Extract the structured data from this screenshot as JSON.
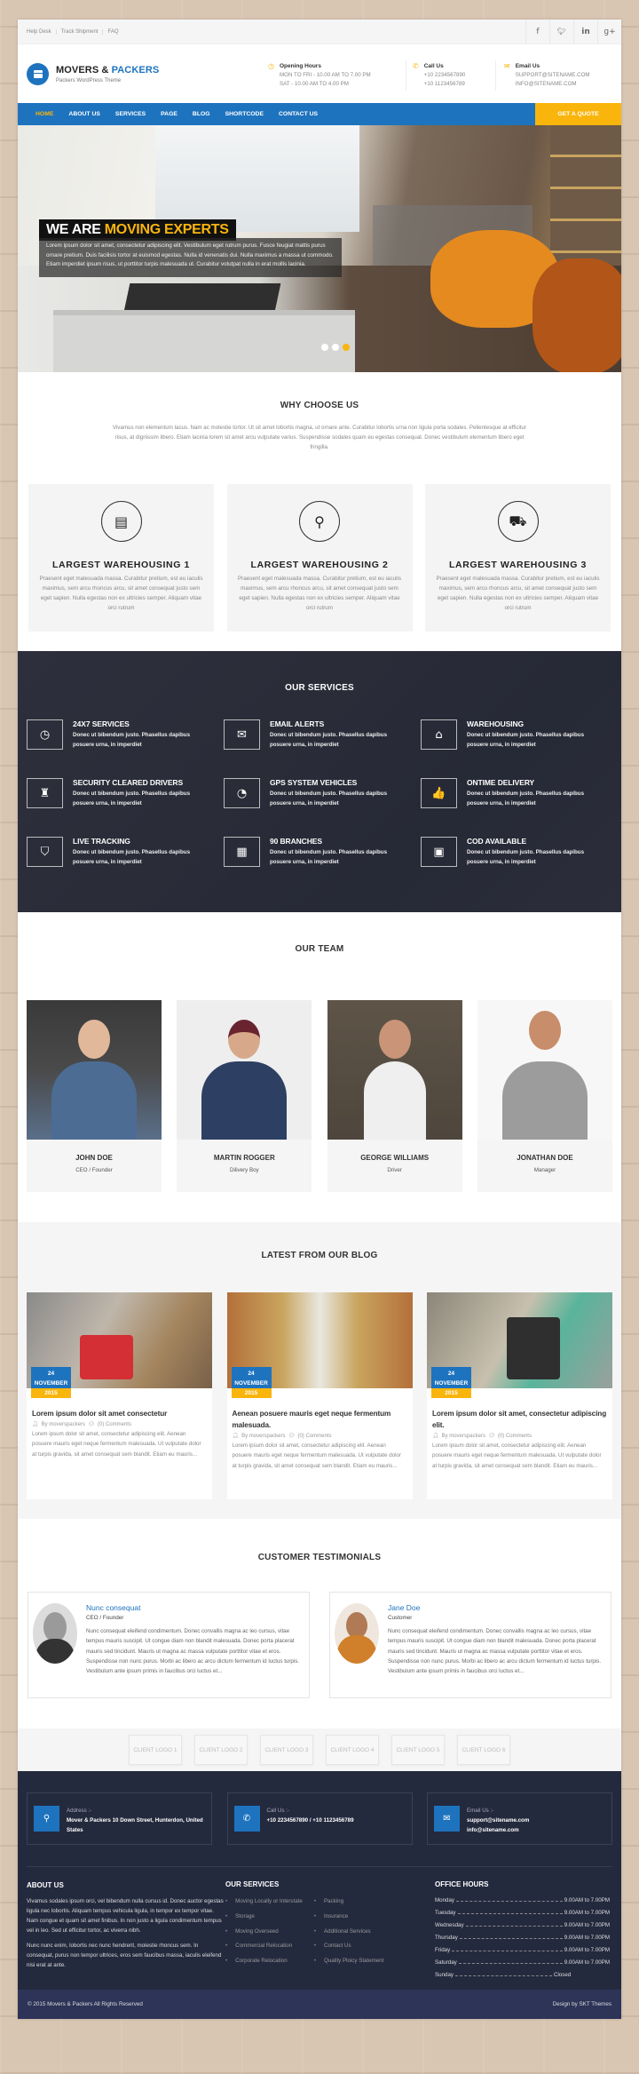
{
  "topbar": {
    "links": [
      "Help Desk",
      "Track Shipment",
      "FAQ"
    ],
    "social": [
      {
        "name": "facebook-icon",
        "glyph": "f"
      },
      {
        "name": "twitter-icon",
        "glyph": "t"
      },
      {
        "name": "linkedin-icon",
        "glyph": "in"
      },
      {
        "name": "google-plus-icon",
        "glyph": "g+"
      }
    ]
  },
  "header": {
    "logo_title_a": "MOVERS & ",
    "logo_title_b": "PACKERS",
    "logo_sub": "Packers WordPress Theme",
    "hours": {
      "title": "Opening Hours",
      "line1": "MON TO FRI - 10.00 AM TO 7.00 PM",
      "line2": "SAT - 10.00 AM TO 4.00 PM"
    },
    "call": {
      "title": "Call Us",
      "line1": "+10 2234567890",
      "line2": "+10 1123456789"
    },
    "email": {
      "title": "Email Us",
      "line1": "SUPPORT@SITENAME.COM",
      "line2": "INFO@SITENAME.COM"
    }
  },
  "nav": {
    "items": [
      "HOME",
      "ABOUT US",
      "SERVICES",
      "PAGE",
      "BLOG",
      "SHORTCODE",
      "CONTACT US"
    ],
    "active": "HOME",
    "cta": "GET A QUOTE"
  },
  "hero": {
    "title_a": "WE ARE ",
    "title_b": "MOVING EXPERTS",
    "text": "Lorem ipsum dolor sit amet, consectetur adipiscing elit. Vestibulum eget rutrum purus. Fusce feugiat mattis purus ornare pretium. Duis facilisis tortor at euismod egestas. Nulla id venenatis dui. Nulla maximus a massa ut commodo. Etiam imperdiet ipsum risus, ut porttitor turpis malesuada ut. Curabitur volutpat nulla in erat mollis lacinia.",
    "slides": 3,
    "active_slide": 3
  },
  "why": {
    "title": "WHY CHOOSE US",
    "intro": "Vivamus non elementum lacus. Nam ac molestie tortor. Ut sit amet lobortis magna, ut ornare ante. Curabitur lobortis urna non ligula porta sodales. Pellentesque at efficitur risus, at dignissim libero. Etiam lacinia lorem sit amet arcu vulputate varius. Suspendisse sodales quam eu egestas consequat. Donec vestibulum elementum libero eget fringilla.",
    "cards": [
      {
        "icon": "archive-box-icon",
        "title": "LARGEST WAREHOUSING 1",
        "text": "Praesent eget malesuada massa. Curabitur pretium, est eu iaculis maximus, sem arcu rhoncus arcu, sit amet consequat justo sem eget sapien. Nulla egestas non ex ultricies semper. Aliquam vitae orci rutrum"
      },
      {
        "icon": "map-pin-icon",
        "title": "LARGEST WAREHOUSING 2",
        "text": "Praesent eget malesuada massa. Curabitur pretium, est eu iaculis maximus, sem arcu rhoncus arcu, sit amet consequat justo sem eget sapien. Nulla egestas non ex ultricies semper. Aliquam vitae orci rutrum"
      },
      {
        "icon": "truck-icon",
        "title": "LARGEST WAREHOUSING 3",
        "text": "Praesent eget malesuada massa. Curabitur pretium, est eu iaculis maximus, sem arcu rhoncus arcu, sit amet consequat justo sem eget sapien. Nulla egestas non ex ultricies semper. Aliquam vitae orci rutrum"
      }
    ]
  },
  "services": {
    "title": "OUR SERVICES",
    "items": [
      {
        "icon": "clock-icon",
        "glyph": "◷",
        "title": "24X7 SERVICES",
        "text": "Donec ut bibendum justo. Phasellus dapibus posuere urna, in imperdiet"
      },
      {
        "icon": "envelope-icon",
        "glyph": "✉",
        "title": "EMAIL ALERTS",
        "text": "Donec ut bibendum justo. Phasellus dapibus posuere urna, in imperdiet"
      },
      {
        "icon": "home-icon",
        "glyph": "⌂",
        "title": "WAREHOUSING",
        "text": "Donec ut bibendum justo. Phasellus dapibus posuere urna, in imperdiet"
      },
      {
        "icon": "money-bag-icon",
        "glyph": "♜",
        "title": "SECURITY CLEARED DRIVERS",
        "text": "Donec ut bibendum justo. Phasellus dapibus posuere urna, in imperdiet"
      },
      {
        "icon": "dashboard-icon",
        "glyph": "◔",
        "title": "GPS SYSTEM VEHICLES",
        "text": "Donec ut bibendum justo. Phasellus dapibus posuere urna, in imperdiet"
      },
      {
        "icon": "thumbs-up-icon",
        "glyph": "👍",
        "title": "ONTIME DELIVERY",
        "text": "Donec ut bibendum justo. Phasellus dapibus posuere urna, in imperdiet"
      },
      {
        "icon": "shield-icon",
        "glyph": "⛉",
        "title": "LIVE TRACKING",
        "text": "Donec ut bibendum justo. Phasellus dapibus posuere urna, in imperdiet"
      },
      {
        "icon": "building-icon",
        "glyph": "▦",
        "title": "90 BRANCHES",
        "text": "Donec ut bibendum justo. Phasellus dapibus posuere urna, in imperdiet"
      },
      {
        "icon": "cash-icon",
        "glyph": "▣",
        "title": "COD AVAILABLE",
        "text": "Donec ut bibendum justo. Phasellus dapibus posuere urna, in imperdiet"
      }
    ]
  },
  "team": {
    "title": "OUR TEAM",
    "members": [
      {
        "name": "JOHN DOE",
        "role": "CEO / Founder"
      },
      {
        "name": "MARTIN ROGGER",
        "role": "Dilivery Boy"
      },
      {
        "name": "GEORGE WILLIAMS",
        "role": "Driver"
      },
      {
        "name": "JONATHAN DOE",
        "role": "Manager"
      }
    ]
  },
  "blog": {
    "title": "LATEST FROM OUR BLOG",
    "posts": [
      {
        "day": "24",
        "month": "NOVEMBER",
        "year": "2015",
        "title": "Lorem ipsum dolor sit amet consectetur",
        "author": "By moverspackers",
        "comments": "(0) Comments",
        "excerpt": "Lorem ipsum dolor sit amet, consectetur adipiscing elit. Aenean posuere mauris eget neque fermentum malesuada. Ut vulputate dolor at turpis gravida, sit amet consequat sem blandit. Etiam eu mauris..."
      },
      {
        "day": "24",
        "month": "NOVEMBER",
        "year": "2015",
        "title": "Aenean posuere mauris eget neque fermentum malesuada.",
        "author": "By moverspackers",
        "comments": "(0) Comments",
        "excerpt": "Lorem ipsum dolor sit amet, consectetur adipiscing elit. Aenean posuere mauris eget neque fermentum malesuada. Ut vulputate dolor at turpis gravida, sit amet consequat sem blandit. Etiam eu mauris..."
      },
      {
        "day": "24",
        "month": "NOVEMBER",
        "year": "2015",
        "title": "Lorem ipsum dolor sit amet, consectetur adipiscing elit.",
        "author": "By moverspackers",
        "comments": "(0) Comments",
        "excerpt": "Lorem ipsum dolor sit amet, consectetur adipiscing elit. Aenean posuere mauris eget neque fermentum malesuada. Ut vulputate dolor at turpis gravida, sit amet consequat sem blandit. Etiam eu mauris..."
      }
    ]
  },
  "testimonials": {
    "title": "CUSTOMER TESTIMONIALS",
    "items": [
      {
        "name": "Nunc consequat",
        "role": "CEO / Founder",
        "text": "Nunc consequat eleifend condimentum. Donec convallis magna ac leo cursus, vitae tempus mauris suscipit. Ut congue diam non blandit malesuada. Donec porta placerat mauris sed tincidunt. Mauris ut magna ac massa vulputate porttitor vitae et eros. Suspendisse non nunc purus. Morbi ac libero ac arcu dictum fermentum id luctus turpis. Vestibulum ante ipsum primis in faucibus orci luctus et..."
      },
      {
        "name": "Jane Doe",
        "role": "Customer",
        "text": "Nunc consequat eleifend condimentum. Donec convallis magna ac leo cursus, vitae tempus mauris suscipit. Ut congue diam non blandit malesuada. Donec porta placerat mauris sed tincidunt. Mauris ut magna ac massa vulputate porttitor vitae et eros. Suspendisse non nunc purus. Morbi ac libero ac arcu dictum fermentum id luctus turpis. Vestibulum ante ipsum primis in faucibus orci luctus et..."
      }
    ]
  },
  "clients": [
    "CLIENT LOGO 1",
    "CLIENT LOGO 2",
    "CLIENT LOGO 3",
    "CLIENT LOGO 4",
    "CLIENT LOGO 5",
    "CLIENT LOGO 6"
  ],
  "footer": {
    "address": {
      "label": "Address :-",
      "value": "Mover & Packers 10 Down Street, Hunterdon, United States"
    },
    "call": {
      "label": "Call Us :-",
      "value": "+10 2234567890 / +10 1123456789"
    },
    "email": {
      "label": "Email Us :-",
      "line1": "support@sitename.com",
      "line2": "info@sitename.com"
    },
    "about": {
      "title": "ABOUT US",
      "p1": "Vivamus sodales ipsum orci, vel bibendum nulla cursus id. Donec auctor egestas ligula nec lobortis. Aliquam tempus vehicula ligula, in tempor ex tempor vitae. Nam congue et quam sit amet finibus. In non justo a ligula condimentum tempus vel in leo. Sed ut efficitur tortor, ac viverra nibh.",
      "p2": "Nunc nunc enim, lobortis nec nunc hendrerit, molestie rhoncus sem. In consequat, purus non tempor ultrices, eros sem faucibus massa, iaculis eleifend nisi erat at ante."
    },
    "services": {
      "title": "OUR SERVICES",
      "col1": [
        "Moving Locally or Interstate",
        "Storage",
        "Moving Overseed",
        "Commercial Relocation",
        "Corporate Relocation"
      ],
      "col2": [
        "Packing",
        "Insurance",
        "Additional Services",
        "Contact Us",
        "Quality Ploicy Statement"
      ]
    },
    "hours": {
      "title": "OFFICE HOURS",
      "rows": [
        {
          "day": "Monday",
          "time": "9.00AM to 7.00PM"
        },
        {
          "day": "Tuesday",
          "time": "9.00AM to 7.00PM"
        },
        {
          "day": "Wednesday",
          "time": "9.00AM to 7.00PM"
        },
        {
          "day": "Thursday",
          "time": "9.00AM to 7.00PM"
        },
        {
          "day": "Friday",
          "time": "9.00AM to 7.00PM"
        },
        {
          "day": "Saturday",
          "time": "9.00AM to 7.00PM"
        },
        {
          "day": "Sunday",
          "time": "Closed"
        }
      ]
    },
    "copyright": "© 2015 Movers & Packers All Rights Reserved",
    "credit": "Design by SKT Themes"
  },
  "colors": {
    "brand_blue": "#1e73be",
    "accent_yellow": "#f9b50c",
    "footer_dark": "#242a3e"
  }
}
